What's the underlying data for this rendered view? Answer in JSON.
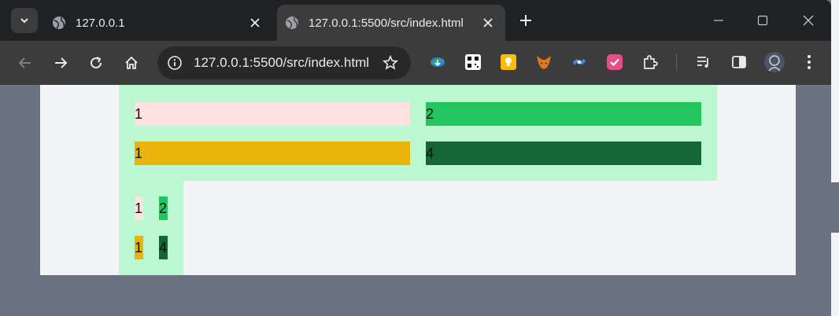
{
  "tabs": [
    {
      "title": "127.0.0.1",
      "active": false
    },
    {
      "title": "127.0.0.1:5500/src/index.html",
      "active": true
    }
  ],
  "toolbar": {
    "url": "127.0.0.1:5500/src/index.html"
  },
  "grid_wide": {
    "cells": [
      {
        "text": "1",
        "color": "#fee2e2"
      },
      {
        "text": "2",
        "color": "#22c55e"
      },
      {
        "text": "1",
        "color": "#eab308"
      },
      {
        "text": "4",
        "color": "#166534"
      }
    ]
  },
  "grid_narrow": {
    "cells": [
      {
        "text": "1",
        "color": "#fee2e2"
      },
      {
        "text": "2",
        "color": "#22c55e"
      },
      {
        "text": "1",
        "color": "#eab308"
      },
      {
        "text": "4",
        "color": "#166534"
      }
    ]
  },
  "colors": {
    "container_bg": "#bbf7d0",
    "page_bg": "#f3f4f6",
    "outer_bg": "#6b7280"
  }
}
